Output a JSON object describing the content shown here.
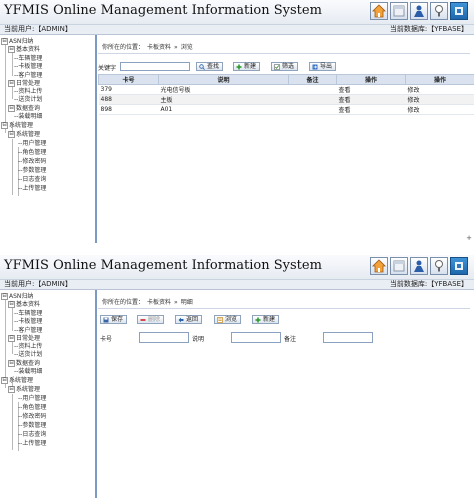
{
  "app_title": "YFMIS Online Management Information System",
  "toolbar_icons": [
    "home-icon",
    "window-icon",
    "user-icon",
    "help-icon",
    "exit-icon"
  ],
  "user_label": "当前用户:【ADMIN】",
  "db_label": "当前数据库:【YFBASE】",
  "sidebar": {
    "nodes": [
      {
        "toggle": "⊟",
        "label": "ASN归纳"
      },
      {
        "toggle": "⊟",
        "label": "基本资料"
      },
      {
        "toggle": "",
        "label": "车辆管理"
      },
      {
        "toggle": "",
        "label": "卡板管理"
      },
      {
        "toggle": "",
        "label": "客户管理"
      },
      {
        "toggle": "⊟",
        "label": "日常处理"
      },
      {
        "toggle": "",
        "label": "资料上传"
      },
      {
        "toggle": "",
        "label": "送货计划"
      },
      {
        "toggle": "⊟",
        "label": "数据查询"
      },
      {
        "toggle": "",
        "label": "装载明细"
      },
      {
        "toggle": "⊟",
        "label": "系统管理"
      },
      {
        "toggle": "⊟",
        "label": "系统管理"
      },
      {
        "toggle": "",
        "label": "用户管理"
      },
      {
        "toggle": "",
        "label": "角色管理"
      },
      {
        "toggle": "",
        "label": "修改密码"
      },
      {
        "toggle": "",
        "label": "参数管理"
      },
      {
        "toggle": "",
        "label": "日志查询"
      },
      {
        "toggle": "",
        "label": "上传管理"
      }
    ]
  },
  "screen1": {
    "breadcrumb": {
      "prefix": "你所在的位置：",
      "module": "卡板资料",
      "sep": "»",
      "page": "浏览"
    },
    "keyword_label": "关键字",
    "buttons": {
      "search": "查找",
      "new": "新建",
      "filter": "筛选",
      "export": "导出"
    },
    "table": {
      "headers": [
        "卡号",
        "说明",
        "备注",
        "操作",
        "操作"
      ],
      "rows": [
        [
          "379",
          "光电信号板",
          "",
          "查看",
          "修改"
        ],
        [
          "488",
          "主板",
          "",
          "查看",
          "修改"
        ],
        [
          "898",
          "A01",
          "",
          "查看",
          "修改"
        ]
      ]
    },
    "cursor_glyph": "+"
  },
  "screen2": {
    "breadcrumb": {
      "prefix": "你所在的位置：",
      "module": "卡板资料",
      "sep": "»",
      "page": "明细"
    },
    "buttons": {
      "save": "保存",
      "delete": "删除",
      "back": "返回",
      "browse": "浏览",
      "new": "新建"
    },
    "fields": {
      "card_no_label": "卡号",
      "card_no_value": "",
      "desc_label": "说明",
      "desc_value": "",
      "remark_label": "备注",
      "remark_value": ""
    }
  }
}
